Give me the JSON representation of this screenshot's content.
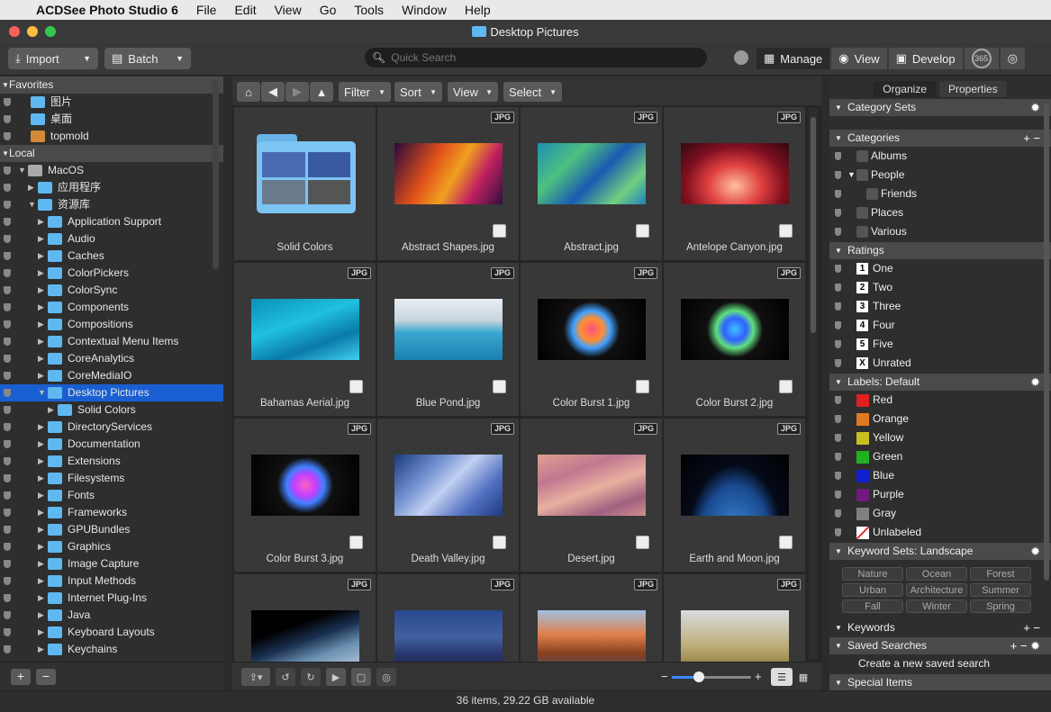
{
  "menubar": {
    "app": "ACDSee Photo Studio 6",
    "items": [
      "File",
      "Edit",
      "View",
      "Go",
      "Tools",
      "Window",
      "Help"
    ]
  },
  "window": {
    "title": "Desktop Pictures"
  },
  "toolbar": {
    "import": "Import",
    "batch": "Batch",
    "search_placeholder": "Quick Search",
    "modes": {
      "manage": "Manage",
      "view": "View",
      "develop": "Develop",
      "badge365": "365"
    }
  },
  "left": {
    "favorites_header": "Favorites",
    "favorites": [
      "图片",
      "桌面",
      "topmold"
    ],
    "local_header": "Local",
    "tree": [
      {
        "label": "MacOS",
        "indent": 0,
        "type": "drive",
        "open": true
      },
      {
        "label": "应用程序",
        "indent": 1,
        "type": "folder",
        "open": false
      },
      {
        "label": "资源库",
        "indent": 1,
        "type": "folder",
        "open": true
      },
      {
        "label": "Application Support",
        "indent": 2
      },
      {
        "label": "Audio",
        "indent": 2
      },
      {
        "label": "Caches",
        "indent": 2
      },
      {
        "label": "ColorPickers",
        "indent": 2
      },
      {
        "label": "ColorSync",
        "indent": 2
      },
      {
        "label": "Components",
        "indent": 2
      },
      {
        "label": "Compositions",
        "indent": 2
      },
      {
        "label": "Contextual Menu Items",
        "indent": 2
      },
      {
        "label": "CoreAnalytics",
        "indent": 2
      },
      {
        "label": "CoreMediaIO",
        "indent": 2
      },
      {
        "label": "Desktop Pictures",
        "indent": 2,
        "open": true,
        "selected": true
      },
      {
        "label": "Solid Colors",
        "indent": 3
      },
      {
        "label": "DirectoryServices",
        "indent": 2
      },
      {
        "label": "Documentation",
        "indent": 2
      },
      {
        "label": "Extensions",
        "indent": 2
      },
      {
        "label": "Filesystems",
        "indent": 2
      },
      {
        "label": "Fonts",
        "indent": 2
      },
      {
        "label": "Frameworks",
        "indent": 2
      },
      {
        "label": "GPUBundles",
        "indent": 2
      },
      {
        "label": "Graphics",
        "indent": 2
      },
      {
        "label": "Image Capture",
        "indent": 2
      },
      {
        "label": "Input Methods",
        "indent": 2
      },
      {
        "label": "Internet Plug-Ins",
        "indent": 2
      },
      {
        "label": "Java",
        "indent": 2
      },
      {
        "label": "Keyboard Layouts",
        "indent": 2
      },
      {
        "label": "Keychains",
        "indent": 2
      }
    ],
    "add": "+",
    "remove": "−"
  },
  "center": {
    "filter": "Filter",
    "sort": "Sort",
    "view": "View",
    "select": "Select",
    "badge": "JPG",
    "items": [
      {
        "name": "Solid Colors",
        "folder": true
      },
      {
        "name": "Abstract Shapes.jpg",
        "bg": "linear-gradient(120deg,#2a0a3a,#e0501a 35%,#f0a020 55%,#c02060 75%,#301040)"
      },
      {
        "name": "Abstract.jpg",
        "bg": "linear-gradient(135deg,#1c8fb0,#4fc080 30%,#1a5ab0 55%,#70d080 80%,#2080c0)"
      },
      {
        "name": "Antelope Canyon.jpg",
        "bg": "radial-gradient(ellipse at 50% 70%,#ffc0a0,#e04040 35%,#801020 65%,#300810)"
      },
      {
        "name": "Bahamas Aerial.jpg",
        "bg": "linear-gradient(160deg,#0a90b8,#20c0e0 40%,#0a7aa8 70%,#40d0f0)"
      },
      {
        "name": "Blue Pond.jpg",
        "bg": "linear-gradient(180deg,#e8eef4 0%,#c8d4de 35%,#3aa8d0 55%,#1a80b0 100%)"
      },
      {
        "name": "Color Burst 1.jpg",
        "bg": "radial-gradient(circle at 50% 50%,#ff5080 0%,#ff9030 18%,#40a0ff 30%,#101010 45%,#000 100%)"
      },
      {
        "name": "Color Burst 2.jpg",
        "bg": "radial-gradient(circle at 50% 50%,#40c0ff 0%,#3060ff 18%,#60e080 30%,#101010 45%,#000 100%)"
      },
      {
        "name": "Color Burst 3.jpg",
        "bg": "radial-gradient(circle at 50% 50%,#ff60c0 0%,#c040ff 18%,#4080ff 30%,#101010 45%,#000 100%)"
      },
      {
        "name": "Death Valley.jpg",
        "bg": "linear-gradient(135deg,#1a3a80,#7090d0 30%,#c0d0f0 50%,#5070c0 75%,#203a80)"
      },
      {
        "name": "Desert.jpg",
        "bg": "linear-gradient(160deg,#e0a090,#c07890 30%,#e8b0a0 55%,#a06080 80%,#d09090)"
      },
      {
        "name": "Earth and Moon.jpg",
        "bg": "radial-gradient(ellipse at 50% 140%,#3a90e0 0%,#1a4a90 45%,#050a18 62%,#000 100%)"
      },
      {
        "name": "",
        "bg": "linear-gradient(160deg,#000 30%,#1a3050 50%,#6a90b0 70%,#c0d0e0)"
      },
      {
        "name": "",
        "bg": "linear-gradient(180deg,#2a4a90 0%,#4060a0 45%,#2a3870 70%,#182448)"
      },
      {
        "name": "",
        "bg": "linear-gradient(180deg,#a0c0e0 0%,#e0804a 40%,#8a4020 70%,#405060)"
      },
      {
        "name": "",
        "bg": "linear-gradient(180deg,#d8dce0 0%,#c0b080 55%,#a09050 80%,#6a6040)"
      }
    ]
  },
  "status": "36 items, 29.22 GB available",
  "right": {
    "tabs": [
      "Organize",
      "Properties"
    ],
    "category_sets": "Category Sets",
    "categories": "Categories",
    "category_items": [
      {
        "label": "Albums",
        "indent": 0
      },
      {
        "label": "People",
        "indent": 0,
        "open": true
      },
      {
        "label": "Friends",
        "indent": 1
      },
      {
        "label": "Places",
        "indent": 0
      },
      {
        "label": "Various",
        "indent": 0
      }
    ],
    "ratings": "Ratings",
    "rating_items": [
      {
        "n": "1",
        "label": "One"
      },
      {
        "n": "2",
        "label": "Two"
      },
      {
        "n": "3",
        "label": "Three"
      },
      {
        "n": "4",
        "label": "Four"
      },
      {
        "n": "5",
        "label": "Five"
      },
      {
        "n": "X",
        "label": "Unrated"
      }
    ],
    "labels": "Labels: Default",
    "label_items": [
      {
        "label": "Red",
        "color": "#e02020"
      },
      {
        "label": "Orange",
        "color": "#e07a20"
      },
      {
        "label": "Yellow",
        "color": "#c8c020"
      },
      {
        "label": "Green",
        "color": "#20b020"
      },
      {
        "label": "Blue",
        "color": "#1020d0"
      },
      {
        "label": "Purple",
        "color": "#701a80"
      },
      {
        "label": "Gray",
        "color": "#808080"
      },
      {
        "label": "Unlabeled",
        "color": "unlabeled"
      }
    ],
    "keyword_sets": "Keyword Sets: Landscape",
    "keywords_grid": [
      "Nature",
      "Ocean",
      "Forest",
      "Urban",
      "Architecture",
      "Summer",
      "Fall",
      "Winter",
      "Spring"
    ],
    "keywords": "Keywords",
    "saved_searches": "Saved Searches",
    "create_saved": "Create a new saved search",
    "special_items": "Special Items"
  }
}
